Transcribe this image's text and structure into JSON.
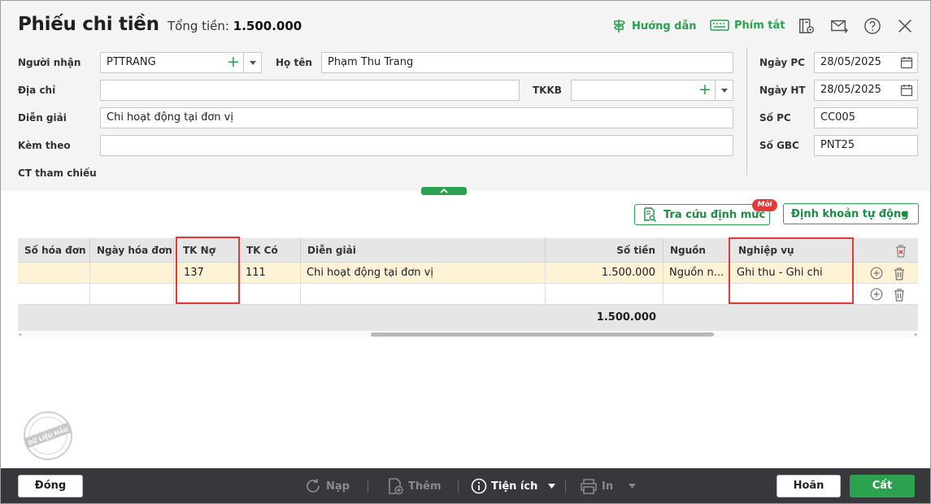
{
  "header": {
    "title": "Phiếu chi tiền",
    "total_label": "Tổng tiền:",
    "total_value": "1.500.000",
    "guide_label": "Hướng dẫn",
    "shortcut_label": "Phím tắt"
  },
  "form": {
    "recipient_label": "Người nhận",
    "recipient_value": "PTTRANG",
    "fullname_label": "Họ tên",
    "fullname_value": "Phạm Thu Trang",
    "address_label": "Địa chỉ",
    "address_value": "",
    "tkkb_label": "TKKB",
    "tkkb_value": "",
    "description_label": "Diễn giải",
    "description_value": "Chi hoạt động tại đơn vị",
    "attached_label": "Kèm theo",
    "attached_value": "",
    "reference_label": "CT tham chiếu",
    "date_pc_label": "Ngày PC",
    "date_pc_value": "28/05/2025",
    "date_ht_label": "Ngày HT",
    "date_ht_value": "28/05/2025",
    "so_pc_label": "Số PC",
    "so_pc_value": "CC005",
    "so_gbc_label": "Số GBC",
    "so_gbc_value": "PNT25"
  },
  "actions": {
    "lookup_label": "Tra cứu định mức",
    "new_badge": "Mới",
    "auto_entry_label": "Định khoản tự động"
  },
  "grid": {
    "columns": [
      "Số hóa đơn",
      "Ngày hóa đơn",
      "TK Nợ",
      "TK Có",
      "Diễn giải",
      "Số tiền",
      "Nguồn",
      "Nghiệp vụ"
    ],
    "rows": [
      {
        "invoice_no": "",
        "invoice_date": "",
        "debit": "137",
        "credit": "111",
        "description": "Chi hoạt động tại đơn vị",
        "amount": "1.500.000",
        "source": "Nguồn n...",
        "operation": "Ghi thu - Ghi chi"
      },
      {
        "invoice_no": "",
        "invoice_date": "",
        "debit": "",
        "credit": "",
        "description": "",
        "amount": "",
        "source": "",
        "operation": ""
      }
    ],
    "total_amount": "1.500.000"
  },
  "footer": {
    "close_label": "Đóng",
    "reload_label": "Nạp",
    "add_label": "Thêm",
    "utility_label": "Tiện ích",
    "print_label": "In",
    "cancel_label": "Hoãn",
    "save_label": "Cất"
  },
  "colors": {
    "accent": "#2aa250",
    "highlight": "#e53935",
    "selected_row": "#fdf1d6",
    "footer_bg": "#37373c"
  }
}
